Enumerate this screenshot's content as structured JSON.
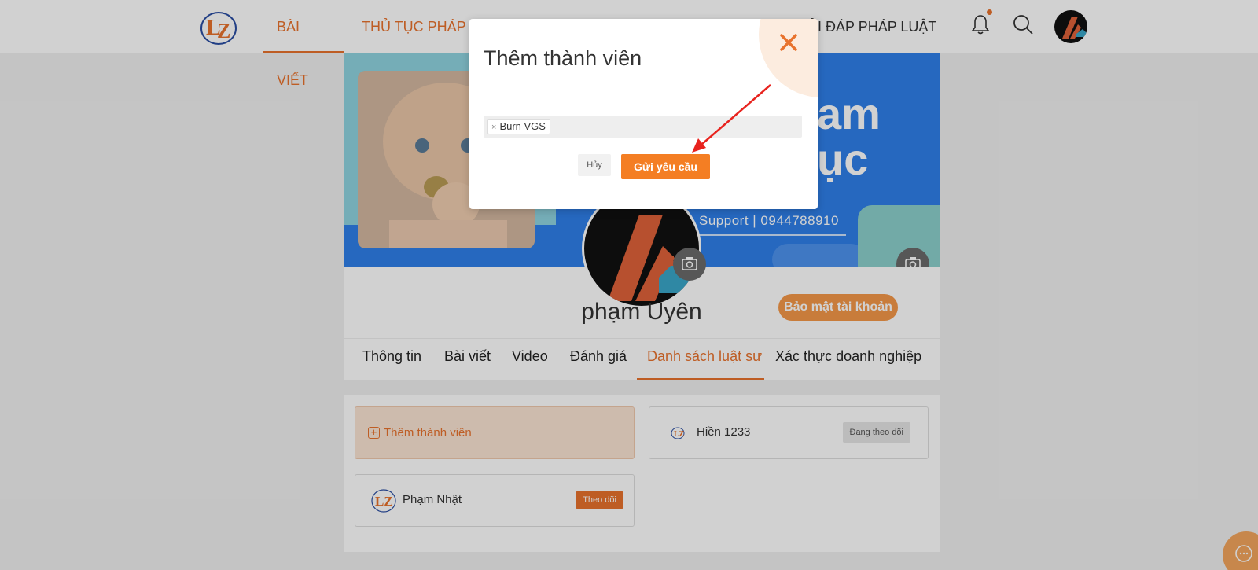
{
  "header": {
    "nav": {
      "posts": "BÀI VIẾT",
      "procedures": "THỦ TỤC PHÁP L",
      "qa": "ỎI ĐÁP PHÁP LUẬT"
    },
    "logo_icon": "lz-logo",
    "bell_icon": "bell-icon",
    "search_icon": "search-icon"
  },
  "profile": {
    "name": "phạm Uyên",
    "security_button": "Bảo mật tài khoản",
    "cover": {
      "text_big_1": "am",
      "text_big_2": "ục",
      "support_text": "Support | 0944788910"
    },
    "tabs": [
      "Thông tin",
      "Bài viết",
      "Video",
      "Đánh giá",
      "Danh sách luật sư",
      "Xác thực doanh nghiệp"
    ],
    "active_tab": "Danh sách luật sư"
  },
  "lawyers": {
    "add_member_label": "Thêm thành viên",
    "members": [
      {
        "name": "Hiền 1233",
        "button": "Đang theo dõi"
      },
      {
        "name": "Phạm Nhật",
        "button": "Theo dõi"
      }
    ]
  },
  "modal": {
    "title": "Thêm thành viên",
    "tags": [
      "Burn VGS"
    ],
    "cancel_label": "Hủy",
    "submit_label": "Gửi yêu cầu"
  },
  "colors": {
    "accent": "#e8722d",
    "cover_blue": "#2f7fe9",
    "submit": "#f47e23"
  }
}
